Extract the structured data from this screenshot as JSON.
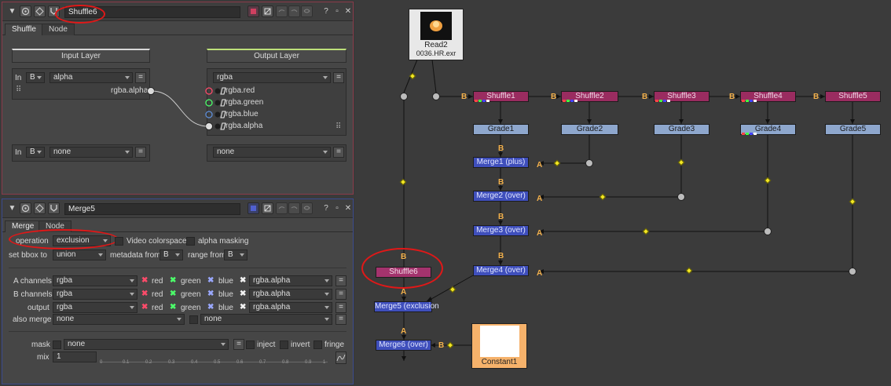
{
  "shuffle_panel": {
    "node_name": "Shuffle6",
    "tabs": [
      "Shuffle",
      "Node"
    ],
    "input_layer_title": "Input Layer",
    "output_layer_title": "Output Layer",
    "in1_label": "In",
    "in1_b": "B",
    "in1_layer": "alpha",
    "in1_channel": "rgba.alpha",
    "out1_layer": "rgba",
    "out1_channels": [
      "rgba.red",
      "rgba.green",
      "rgba.blue",
      "rgba.alpha"
    ],
    "in2_label": "In",
    "in2_b": "B",
    "in2_layer": "none",
    "out2_layer": "none",
    "equals": "="
  },
  "merge_panel": {
    "node_name": "Merge5",
    "tabs": [
      "Merge",
      "Node"
    ],
    "operation_label": "operation",
    "operation_value": "exclusion",
    "video_colorspace_label": "Video colorspace",
    "alpha_masking_label": "alpha masking",
    "bbox_label": "set bbox to",
    "bbox_value": "union",
    "metadata_label": "metadata from",
    "metadata_value": "B",
    "range_label": "range from",
    "range_value": "B",
    "channel_rows": [
      {
        "label": "A channels",
        "layer": "rgba",
        "r": "red",
        "g": "green",
        "b": "blue",
        "alpha": "rgba.alpha"
      },
      {
        "label": "B channels",
        "layer": "rgba",
        "r": "red",
        "g": "green",
        "b": "blue",
        "alpha": "rgba.alpha"
      },
      {
        "label": "output",
        "layer": "rgba",
        "r": "red",
        "g": "green",
        "b": "blue",
        "alpha": "rgba.alpha"
      }
    ],
    "also_merge_label": "also merge",
    "also_merge_value": "none",
    "also_merge_value2": "none",
    "mask_label": "mask",
    "mask_value": "none",
    "inject_label": "inject",
    "invert_label": "invert",
    "fringe_label": "fringe",
    "mix_label": "mix",
    "mix_value": "1",
    "mix_ticks": [
      "0",
      "0.1",
      "0.2",
      "0.3",
      "0.4",
      "0.5",
      "0.6",
      "0.7",
      "0.8",
      "0.9",
      "1"
    ],
    "equals": "="
  },
  "graph": {
    "read_node": {
      "name": "Read2",
      "file": "0036.HR.exr"
    },
    "shuffles": [
      "Shuffle1",
      "Shuffle2",
      "Shuffle3",
      "Shuffle4",
      "Shuffle5"
    ],
    "grades": [
      "Grade1",
      "Grade2",
      "Grade3",
      "Grade4",
      "Grade5"
    ],
    "merges": [
      "Merge1 (plus)",
      "Merge2 (over)",
      "Merge3 (over)",
      "Merge4 (over)"
    ],
    "shuffle6": "Shuffle6",
    "merge5": "Merge5 (exclusion",
    "merge6": "Merge6 (over)",
    "constant": "Constant1",
    "input_b": "B",
    "input_a": "A"
  },
  "colors": {
    "annotation": "#e01818",
    "shuffle_node": "#9a2c60",
    "grade_node": "#8ea7cd",
    "merge_node": "#3f4fbc",
    "input_label": "#f3b14c",
    "dot_marker": "#f2e624"
  }
}
